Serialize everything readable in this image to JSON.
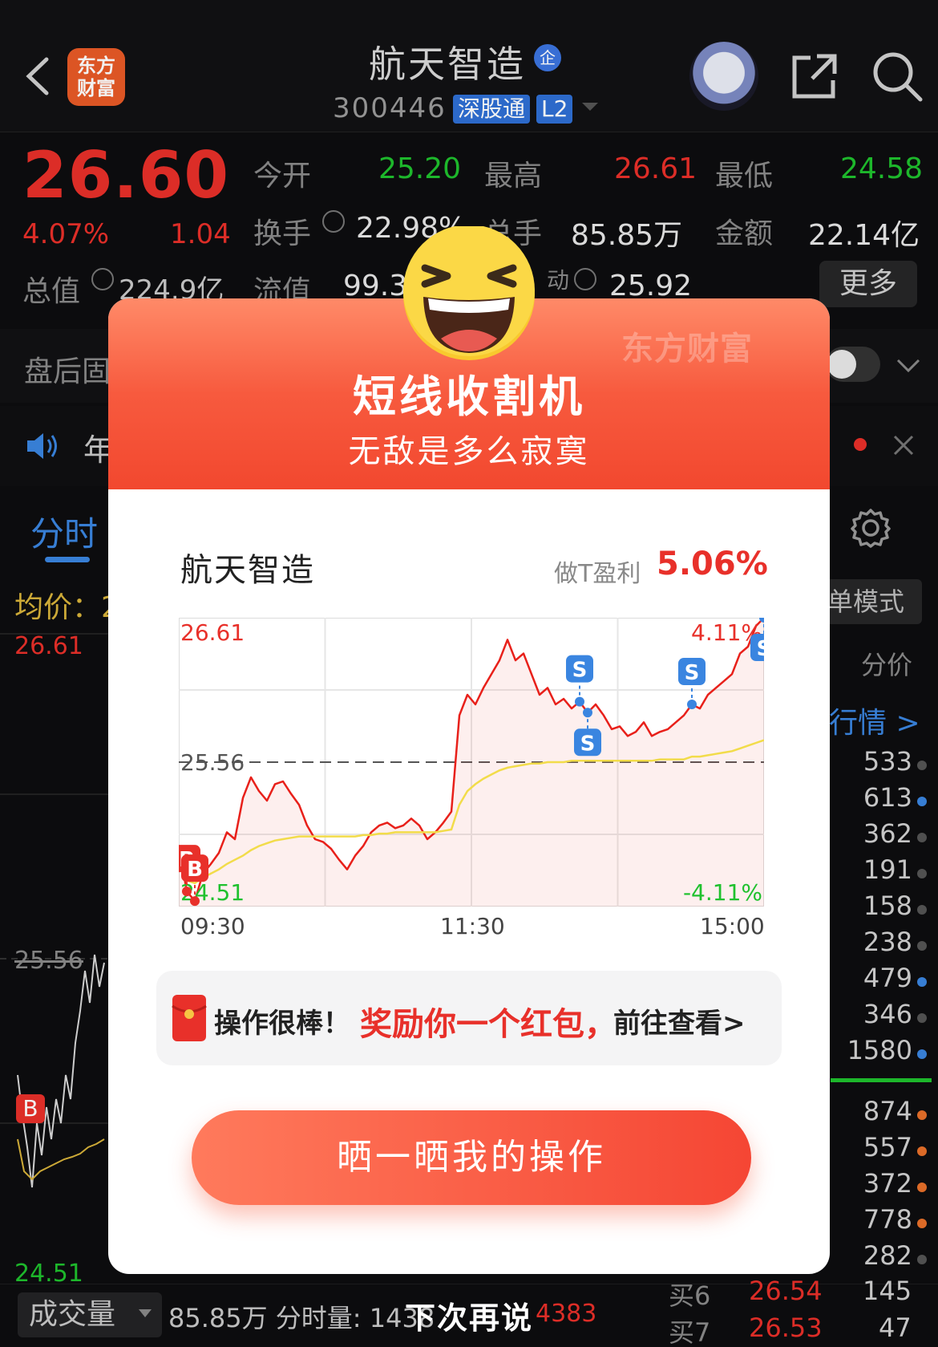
{
  "header": {
    "back_icon": "chevron-left-icon",
    "app_logo_line1": "东方",
    "app_logo_line2": "财富",
    "title": "航天智造",
    "qi_badge": "企",
    "code": "300446",
    "badge_sgt": "深股通",
    "badge_l2": "L2",
    "share_icon": "share-icon",
    "search_icon": "search-icon"
  },
  "quote": {
    "price": "26.60",
    "change_pct": "4.07%",
    "change_abs": "1.04",
    "open_label": "今开",
    "open_val": "25.20",
    "high_label": "最高",
    "high_val": "26.61",
    "low_label": "最低",
    "low_val": "24.58",
    "turnover_label": "换手",
    "turnover_val": "22.98%",
    "volume_label": "总手",
    "volume_val": "85.85万",
    "amount_label": "金额",
    "amount_val": "22.14亿",
    "mktcap_label": "总值",
    "mktcap_val": "224.9亿",
    "float_label": "流值",
    "float_val": "99.3",
    "pe_label": "动",
    "pe_val": "25.92",
    "more_button": "更多"
  },
  "after_hours": {
    "label": "盘后固"
  },
  "notice": {
    "text": "年"
  },
  "tabs": {
    "fenshi": "分时"
  },
  "background_chart": {
    "avg_label": "均价：",
    "avg_val": "2",
    "high": "26.61",
    "mid": "25.56",
    "low": "24.51",
    "b_marker": "B"
  },
  "right_panel": {
    "single_mode": "单模式",
    "price_label": "分价",
    "hangqing_link": "行情 >",
    "volumes_top": [
      {
        "v": "533",
        "dot": "#555555"
      },
      {
        "v": "613",
        "dot": "#3a85e0"
      },
      {
        "v": "362",
        "dot": "#555555"
      },
      {
        "v": "191",
        "dot": "#555555"
      },
      {
        "v": "158",
        "dot": "#555555"
      },
      {
        "v": "238",
        "dot": "#555555"
      },
      {
        "v": "479",
        "dot": "#3a85e0"
      },
      {
        "v": "346",
        "dot": "#555555"
      },
      {
        "v": "1580",
        "dot": "#3a85e0"
      }
    ],
    "volumes_bottom": [
      {
        "v": "874",
        "dot": "#e8702a"
      },
      {
        "v": "557",
        "dot": "#e8702a"
      },
      {
        "v": "372",
        "dot": "#e8702a"
      },
      {
        "v": "778",
        "dot": "#e8702a"
      },
      {
        "v": "282",
        "dot": "#555555"
      }
    ]
  },
  "bottom": {
    "vol_select": "成交量",
    "vol_total": "85.85万 分时量: 1438",
    "vol_extra": "4383",
    "buy6_label": "买6",
    "buy6_price": "26.54",
    "buy6_vol": "145",
    "buy7_label": "买7",
    "buy7_price": "26.53",
    "buy7_vol": "47"
  },
  "modal": {
    "watermark": "东方财富",
    "title": "短线收割机",
    "subtitle": "无敌是多么寂寞",
    "stock_name": "航天智造",
    "profit_label": "做T盈利",
    "profit_val": "5.06%",
    "chart_high_label": "26.61",
    "chart_mid_label": "25.56",
    "chart_low_label": "24.51",
    "chart_pct_high": "4.11%",
    "chart_pct_low": "-4.11%",
    "time_labels": [
      "09:30",
      "11:30",
      "15:00"
    ],
    "buy_marker": "B",
    "sell_marker": "S",
    "reward_text1": "操作很棒！",
    "reward_text2": "奖励你一个红包，",
    "reward_text3": "前往查看>",
    "share_button": "晒一晒我的操作",
    "dismiss": "下次再说"
  },
  "chart_data": {
    "type": "line",
    "title": "",
    "xlabel": "",
    "ylabel": "",
    "x_ticks": [
      "09:30",
      "11:30",
      "15:00"
    ],
    "ylim": [
      24.51,
      26.61
    ],
    "reference_line": 25.56,
    "series": [
      {
        "values": [
          24.95,
          24.62,
          24.55,
          24.75,
          24.82,
          24.9,
          25.05,
          25.0,
          25.3,
          25.45,
          25.35,
          25.28,
          25.4,
          25.42,
          25.33,
          25.25,
          25.1,
          25.0,
          24.98,
          24.93,
          24.85,
          24.78,
          24.88,
          24.95,
          25.05,
          25.1,
          25.12,
          25.08,
          25.1,
          25.15,
          25.1,
          25.0,
          25.05,
          25.12,
          25.2,
          25.9,
          26.05,
          25.98,
          26.1,
          26.2,
          26.3,
          26.45,
          26.3,
          26.35,
          26.2,
          26.05,
          26.1,
          25.98,
          26.02,
          25.95,
          26.0,
          25.92,
          25.98,
          25.9,
          25.8,
          25.82,
          25.75,
          25.78,
          25.85,
          25.75,
          25.78,
          25.8,
          25.85,
          25.9,
          25.98,
          25.95,
          26.05,
          26.1,
          26.15,
          26.2,
          26.35,
          26.4,
          26.55,
          26.61
        ],
        "style": "price"
      },
      {
        "values": [
          24.95,
          24.7,
          24.68,
          24.72,
          24.75,
          24.78,
          24.82,
          24.85,
          24.88,
          24.92,
          24.95,
          24.97,
          24.99,
          25.0,
          25.01,
          25.02,
          25.02,
          25.02,
          25.02,
          25.02,
          25.02,
          25.02,
          25.02,
          25.03,
          25.03,
          25.04,
          25.04,
          25.05,
          25.05,
          25.05,
          25.05,
          25.05,
          25.05,
          25.06,
          25.07,
          25.25,
          25.35,
          25.4,
          25.44,
          25.47,
          25.5,
          25.52,
          25.53,
          25.54,
          25.55,
          25.55,
          25.56,
          25.56,
          25.56,
          25.57,
          25.57,
          25.57,
          25.57,
          25.57,
          25.57,
          25.57,
          25.57,
          25.57,
          25.57,
          25.57,
          25.58,
          25.58,
          25.58,
          25.58,
          25.6,
          25.6,
          25.61,
          25.62,
          25.63,
          25.64,
          25.66,
          25.68,
          25.7,
          25.72
        ],
        "style": "average"
      }
    ],
    "markers": [
      {
        "type": "B",
        "index": 1,
        "value": 24.62
      },
      {
        "type": "B",
        "index": 2,
        "value": 24.55
      },
      {
        "type": "S",
        "index": 50,
        "value": 26.0
      },
      {
        "type": "S",
        "index": 51,
        "value": 25.92
      },
      {
        "type": "S",
        "index": 64,
        "value": 25.98
      },
      {
        "type": "S",
        "index": 73,
        "value": 26.61
      }
    ],
    "grid": true
  }
}
